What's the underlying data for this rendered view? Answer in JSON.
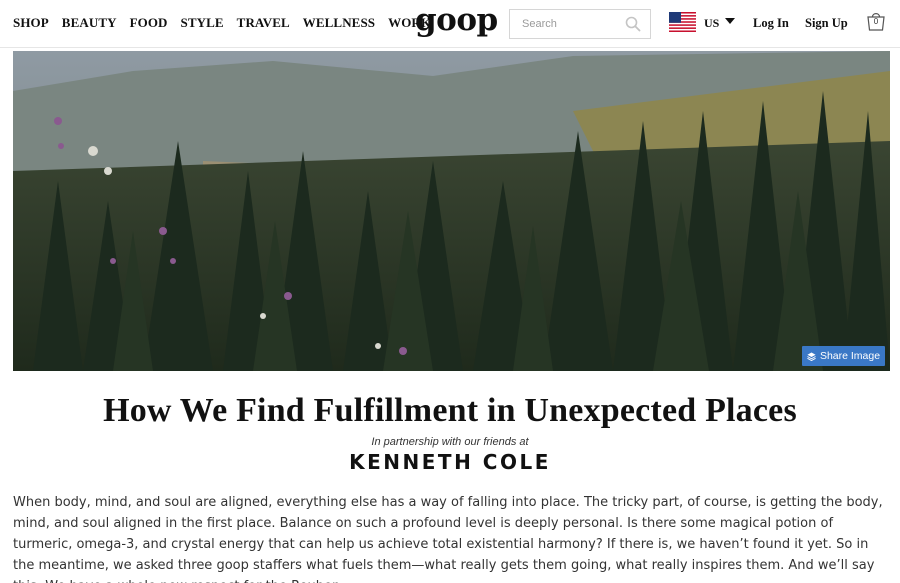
{
  "nav": {
    "items": [
      "SHOP",
      "BEAUTY",
      "FOOD",
      "STYLE",
      "TRAVEL",
      "WELLNESS",
      "WORK"
    ]
  },
  "logo": "goop",
  "search": {
    "placeholder": "Search"
  },
  "locale": {
    "country": "US",
    "flag_icon": "us-flag-icon"
  },
  "account": {
    "login": "Log In",
    "signup": "Sign Up"
  },
  "cart": {
    "count": "0"
  },
  "hero": {
    "share_label": "Share Image",
    "share_color": "#3a78c6"
  },
  "article": {
    "title": "How We Find Fulfillment in Unexpected Places",
    "partner_line": "In partnership with our friends at",
    "partner_brand": "KENNETH COLE",
    "intro": "When body, mind, and soul are aligned, everything else has a way of falling into place. The tricky part, of course, is getting the body, mind, and soul aligned in the first place. Balance on such a profound level is deeply personal. Is there some magical potion of turmeric, omega-3, and crystal energy that can help us achieve total existential harmony? If there is, we haven’t found it yet. So in the meantime, we asked three goop staffers what fuels them—what really gets them going, what really inspires them. And we’ll say this: We have a whole new respect for the Reuben."
  }
}
